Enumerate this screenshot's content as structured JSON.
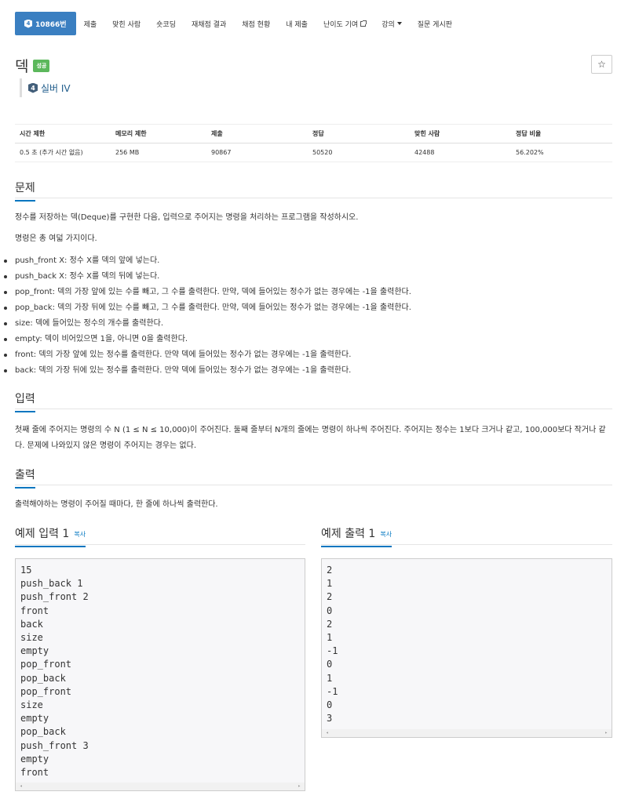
{
  "nav": {
    "problem_tab": {
      "badge": "4",
      "label": "10866번"
    },
    "items": [
      "제출",
      "맞힌 사람",
      "숏코딩",
      "재채점 결과",
      "채점 현황",
      "내 제출"
    ],
    "contribute": "난이도 기여",
    "lecture": "강의",
    "qna": "질문 게시판"
  },
  "problem": {
    "title": "덱",
    "status": "성공",
    "star": "☆",
    "tier_badge": "4",
    "tier": "실버 IV"
  },
  "info_table": {
    "headers": [
      "시간 제한",
      "메모리 제한",
      "제출",
      "정답",
      "맞힌 사람",
      "정답 비율"
    ],
    "values": [
      "0.5 초 (추가 시간 없음)",
      "256 MB",
      "90867",
      "50520",
      "42488",
      "56.202%"
    ]
  },
  "sections": {
    "description_title": "문제",
    "description": [
      "정수를 저장하는 덱(Deque)를 구현한 다음, 입력으로 주어지는 명령을 처리하는 프로그램을 작성하시오.",
      "명령은 총 여덟 가지이다."
    ],
    "commands": [
      "push_front X: 정수 X를 덱의 앞에 넣는다.",
      "push_back X: 정수 X를 덱의 뒤에 넣는다.",
      "pop_front: 덱의 가장 앞에 있는 수를 빼고, 그 수를 출력한다. 만약, 덱에 들어있는 정수가 없는 경우에는 -1을 출력한다.",
      "pop_back: 덱의 가장 뒤에 있는 수를 빼고, 그 수를 출력한다. 만약, 덱에 들어있는 정수가 없는 경우에는 -1을 출력한다.",
      "size: 덱에 들어있는 정수의 개수를 출력한다.",
      "empty: 덱이 비어있으면 1을, 아니면 0을 출력한다.",
      "front: 덱의 가장 앞에 있는 정수를 출력한다. 만약 덱에 들어있는 정수가 없는 경우에는 -1을 출력한다.",
      "back: 덱의 가장 뒤에 있는 정수를 출력한다. 만약 덱에 들어있는 정수가 없는 경우에는 -1을 출력한다."
    ],
    "input_title": "입력",
    "input_text": "첫째 줄에 주어지는 명령의 수 N (1 ≤ N ≤ 10,000)이 주어진다. 둘째 줄부터 N개의 줄에는 명령이 하나씩 주어진다. 주어지는 정수는 1보다 크거나 같고, 100,000보다 작거나 같다. 문제에 나와있지 않은 명령이 주어지는 경우는 없다.",
    "output_title": "출력",
    "output_text": "출력해야하는 명령이 주어질 때마다, 한 줄에 하나씩 출력한다."
  },
  "samples": {
    "input_title": "예제 입력 1",
    "output_title": "예제 출력 1",
    "copy_label": "복사",
    "input": "15\npush_back 1\npush_front 2\nfront\nback\nsize\nempty\npop_front\npop_back\npop_front\nsize\nempty\npop_back\npush_front 3\nempty\nfront",
    "output": "2\n1\n2\n0\n2\n1\n-1\n0\n1\n-1\n0\n3"
  },
  "colors": {
    "accent": "#3a7fc1",
    "success": "#5cb85c",
    "link": "#0076c0"
  }
}
